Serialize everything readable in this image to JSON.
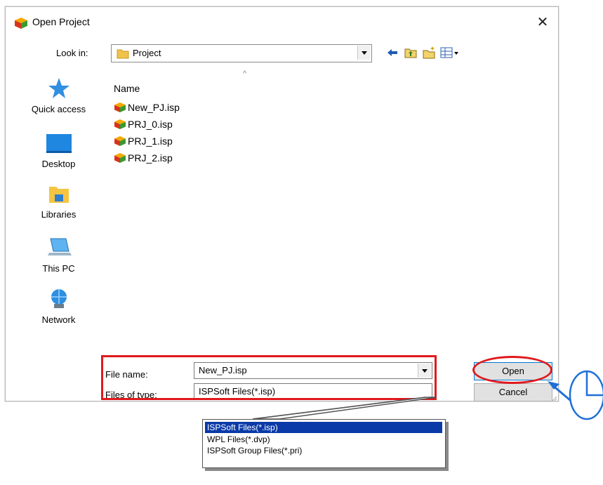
{
  "dialog": {
    "title": "Open Project",
    "close_glyph": "✕"
  },
  "lookin": {
    "label": "Look in:",
    "value": "Project"
  },
  "toolbar": {
    "icons": [
      "back-icon",
      "up-folder-icon",
      "new-folder-icon",
      "view-menu-icon"
    ]
  },
  "places": [
    {
      "label": "Quick access",
      "icon": "quick-access-star-icon"
    },
    {
      "label": "Desktop",
      "icon": "desktop-icon"
    },
    {
      "label": "Libraries",
      "icon": "libraries-icon"
    },
    {
      "label": "This PC",
      "icon": "this-pc-icon"
    },
    {
      "label": "Network",
      "icon": "network-icon"
    }
  ],
  "filelist": {
    "column_name": "Name",
    "sort_glyph": "^",
    "files": [
      "New_PJ.isp",
      "PRJ_0.isp",
      "PRJ_1.isp",
      "PRJ_2.isp"
    ]
  },
  "filename": {
    "label": "File name:",
    "value": "New_PJ.isp"
  },
  "filetype": {
    "label": "Files of type:",
    "value": "ISPSoft Files(*.isp)",
    "options": [
      "ISPSoft Files(*.isp)",
      "WPL Files(*.dvp)",
      "ISPSoft Group Files(*.pri)"
    ],
    "selected_index": 0
  },
  "buttons": {
    "open": "Open",
    "cancel": "Cancel"
  },
  "colors": {
    "highlight": "#e0191c",
    "selection": "#0a3aa8",
    "annotation_blue": "#1f6fd6"
  }
}
